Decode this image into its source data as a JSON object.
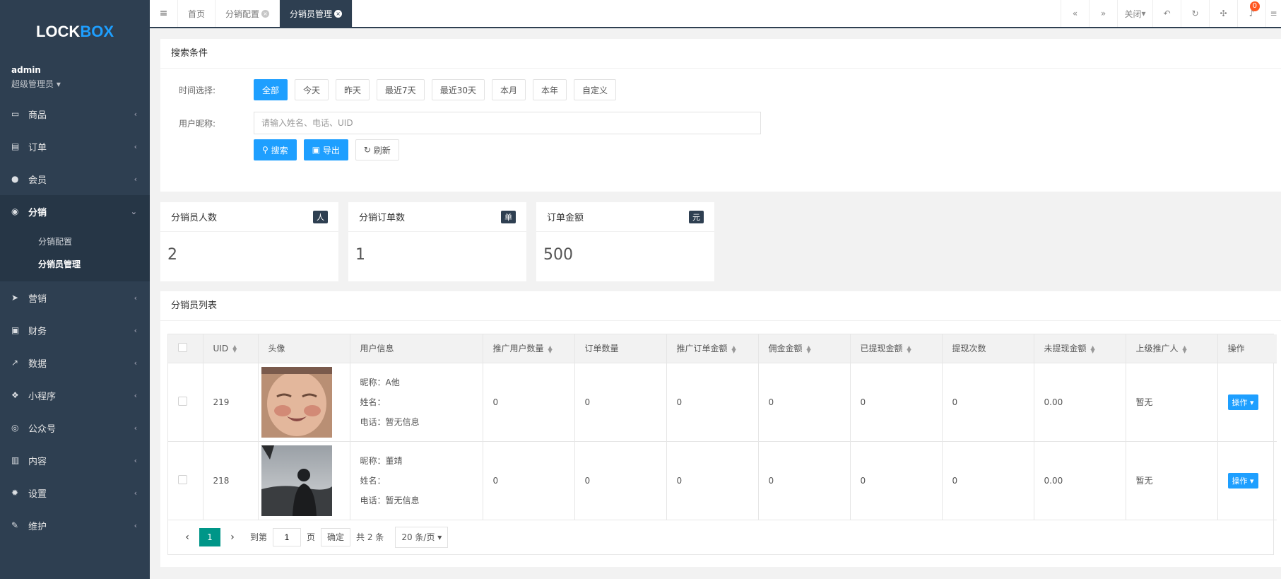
{
  "sidebar": {
    "logo": {
      "part1": "LOCK",
      "part2": "BOX"
    },
    "user": {
      "name": "admin",
      "role": "超级管理员"
    },
    "items": [
      {
        "icon": "laptop-icon",
        "label": "商品"
      },
      {
        "icon": "file-icon",
        "label": "订单"
      },
      {
        "icon": "user-icon",
        "label": "会员"
      },
      {
        "icon": "users-icon",
        "label": "分销"
      },
      {
        "icon": "send-icon",
        "label": "营销"
      },
      {
        "icon": "money-icon",
        "label": "财务"
      },
      {
        "icon": "chart-icon",
        "label": "数据"
      },
      {
        "icon": "cubes-icon",
        "label": "小程序"
      },
      {
        "icon": "wechat-icon",
        "label": "公众号"
      },
      {
        "icon": "book-icon",
        "label": "内容"
      },
      {
        "icon": "gear-icon",
        "label": "设置"
      },
      {
        "icon": "wrench-icon",
        "label": "维护"
      }
    ],
    "sub": [
      "分销配置",
      "分销员管理"
    ]
  },
  "topbar": {
    "tabs": [
      "首页",
      "分销配置",
      "分销员管理"
    ],
    "close_label": "关闭",
    "badge": "0"
  },
  "search": {
    "title": "搜索条件",
    "time_label": "时间选择:",
    "time_options": [
      "全部",
      "今天",
      "昨天",
      "最近7天",
      "最近30天",
      "本月",
      "本年",
      "自定义"
    ],
    "nick_label": "用户昵称:",
    "placeholder": "请输入姓名、电话、UID",
    "search_btn": "搜索",
    "export_btn": "导出",
    "refresh_btn": "刷新"
  },
  "stats": [
    {
      "title": "分销员人数",
      "badge": "人",
      "value": "2"
    },
    {
      "title": "分销订单数",
      "badge": "单",
      "value": "1"
    },
    {
      "title": "订单金额",
      "badge": "元",
      "value": "500"
    }
  ],
  "list": {
    "title": "分销员列表",
    "columns": [
      "UID",
      "头像",
      "用户信息",
      "推广用户数量",
      "订单数量",
      "推广订单金额",
      "佣金金额",
      "已提现金额",
      "提现次数",
      "未提现金额",
      "上级推广人",
      "操作"
    ],
    "rows": [
      {
        "uid": "219",
        "nick": "昵称：A他",
        "name": "姓名：",
        "phone": "电话：暂无信息",
        "promo_users": "0",
        "orders": "0",
        "promo_amount": "0",
        "commission": "0",
        "withdrawn": "0",
        "withdraw_count": "0",
        "unwithdrawn": "0.00",
        "superior": "暂无",
        "op": "操作"
      },
      {
        "uid": "218",
        "nick": "昵称：董靖",
        "name": "姓名：",
        "phone": "电话：暂无信息",
        "promo_users": "0",
        "orders": "0",
        "promo_amount": "0",
        "commission": "0",
        "withdrawn": "0",
        "withdraw_count": "0",
        "unwithdrawn": "0.00",
        "superior": "暂无",
        "op": "操作"
      }
    ]
  },
  "pager": {
    "current": "1",
    "goto_label": "到第",
    "page_input": "1",
    "page_label": "页",
    "confirm": "确定",
    "total": "共 2 条",
    "per_page": "20 条/页"
  }
}
